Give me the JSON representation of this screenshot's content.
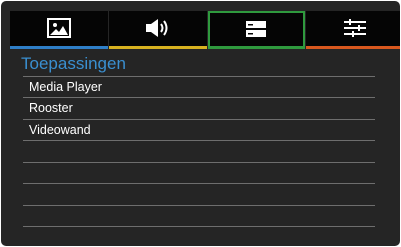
{
  "tabs": [
    {
      "name": "picture",
      "icon": "picture-icon",
      "accent": "#2f7fc8",
      "active": false
    },
    {
      "name": "sound",
      "icon": "speaker-icon",
      "accent": "#d8b220",
      "active": false
    },
    {
      "name": "applications",
      "icon": "app-list-icon",
      "accent": "#2f9a3e",
      "active": true
    },
    {
      "name": "settings",
      "icon": "sliders-icon",
      "accent": "#d8581e",
      "active": false
    }
  ],
  "section": {
    "title": "Toepassingen"
  },
  "menu": {
    "items": [
      {
        "label": "Media Player"
      },
      {
        "label": "Rooster"
      },
      {
        "label": "Videowand"
      },
      {
        "label": ""
      },
      {
        "label": ""
      },
      {
        "label": ""
      },
      {
        "label": ""
      },
      {
        "label": ""
      }
    ]
  },
  "colors": {
    "background": "#252525",
    "tabbar": "#050505",
    "title": "#3a8fd0",
    "text": "#ffffff",
    "divider": "#6e6e6e"
  }
}
